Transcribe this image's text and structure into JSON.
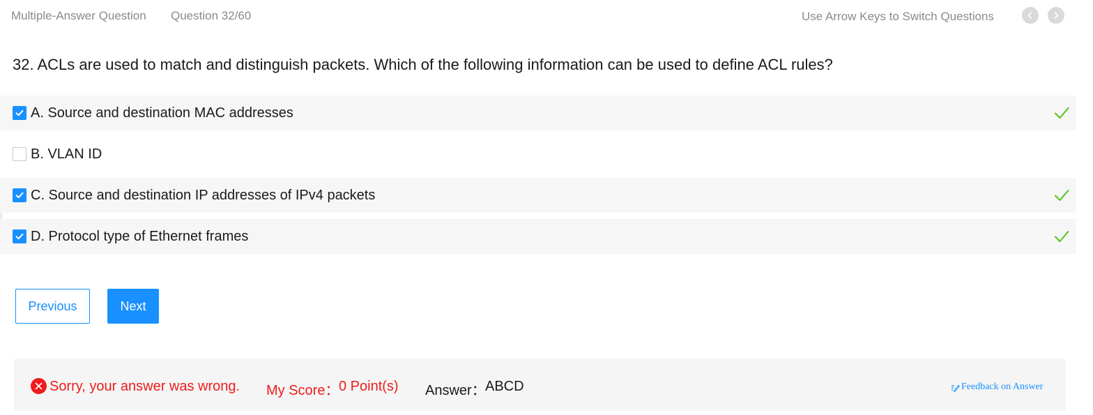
{
  "header": {
    "question_type": "Multiple-Answer Question",
    "question_count": "Question 32/60",
    "hint": "Use Arrow Keys to Switch Questions",
    "prev_icon": "chevron-left-icon",
    "next_icon": "chevron-right-icon"
  },
  "question": {
    "text": "32. ACLs are used to match and distinguish packets. Which of the following information can be used to define ACL rules?"
  },
  "options": [
    {
      "label": "A. Source and destination MAC addresses",
      "checked": true,
      "correct": true
    },
    {
      "label": "B. VLAN ID",
      "checked": false,
      "correct": false
    },
    {
      "label": "C. Source and destination IP addresses of IPv4 packets",
      "checked": true,
      "correct": true
    },
    {
      "label": "D. Protocol type of Ethernet frames",
      "checked": true,
      "correct": true
    }
  ],
  "buttons": {
    "previous": "Previous",
    "next": "Next"
  },
  "result": {
    "message": "Sorry, your answer was wrong.",
    "score_label": "My Score：",
    "score_value": "0 Point(s)",
    "answer_label": "Answer：",
    "answer_value": "ABCD",
    "feedback": "Feedback on Answer"
  },
  "colors": {
    "accent": "#1890ff",
    "error": "#ee1c1c",
    "correct": "#52c41a"
  }
}
